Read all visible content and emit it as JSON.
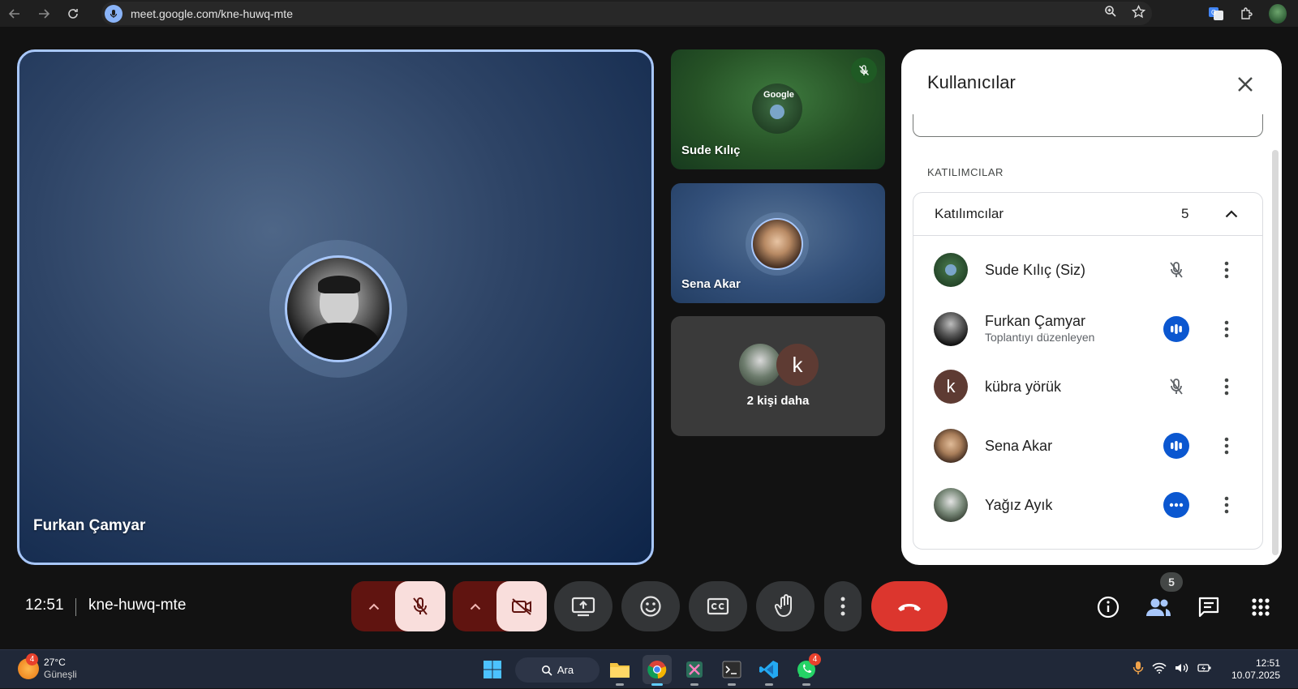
{
  "browser": {
    "url": "meet.google.com/kne-huwq-mte"
  },
  "main_tile": {
    "name": "Furkan Çamyar"
  },
  "side_tiles": {
    "sude": {
      "name": "Sude Kılıç"
    },
    "sena": {
      "name": "Sena Akar"
    },
    "more": {
      "label": "2 kişi daha",
      "avatar_letter": "k"
    }
  },
  "panel": {
    "title": "Kullanıcılar",
    "section_label": "KATILIMCILAR",
    "group": {
      "title": "Katılımcılar",
      "count": "5"
    },
    "participants": [
      {
        "name": "Sude Kılıç (Siz)",
        "subtitle": "",
        "status": "muted-icon"
      },
      {
        "name": "Furkan Çamyar",
        "subtitle": "Toplantıyı düzenleyen",
        "status": "speaking-icon"
      },
      {
        "name": "kübra yörük",
        "subtitle": "",
        "status": "muted-icon",
        "avatar_letter": "k"
      },
      {
        "name": "Sena Akar",
        "subtitle": "",
        "status": "speaking-icon"
      },
      {
        "name": "Yağız Ayık",
        "subtitle": "",
        "status": "more-dots-icon"
      }
    ]
  },
  "bottom_bar": {
    "time": "12:51",
    "meeting_code": "kne-huwq-mte",
    "people_count": "5"
  },
  "taskbar": {
    "weather_temp": "27°C",
    "weather_cond": "Güneşli",
    "weather_badge": "4",
    "search_label": "Ara",
    "whatsapp_badge": "4",
    "clock_time": "12:51",
    "clock_date": "10.07.2025"
  },
  "colors": {
    "accent_blue": "#0b57d0",
    "tile_border": "#a8c7fa",
    "end_call_red": "#dc362e",
    "mute_red_bg": "#601410",
    "mute_pink": "#f9dedc"
  }
}
